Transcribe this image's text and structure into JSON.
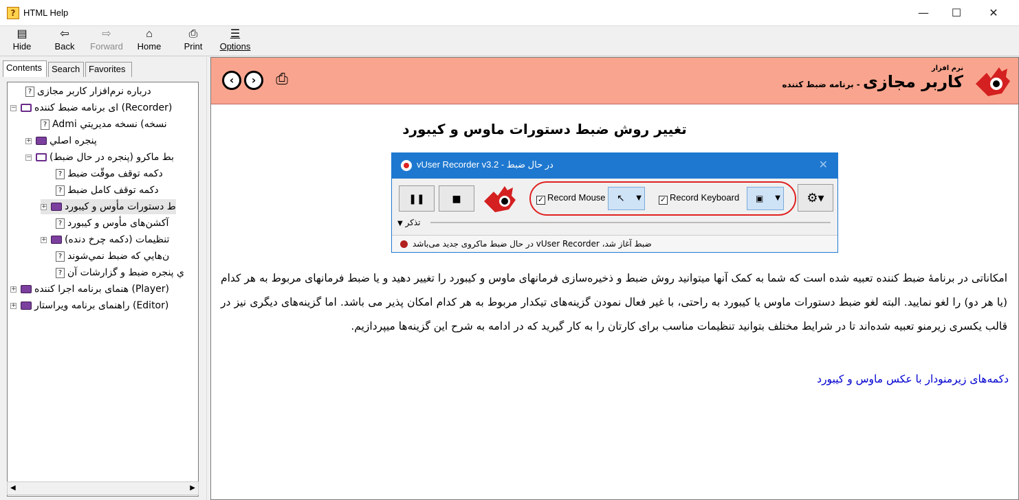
{
  "window": {
    "title": "HTML Help",
    "min": "—",
    "max": "☐",
    "close": "✕"
  },
  "toolbar": {
    "hide": "Hide",
    "back": "Back",
    "forward": "Forward",
    "home": "Home",
    "print": "Print",
    "options": "Options"
  },
  "tabs": {
    "contents": "Contents",
    "search": "Search",
    "favorites": "Favorites"
  },
  "tree": [
    "درباره نرم‌افزار کاربر مجازی",
    "ای برنامه ضبط کننده (Recorder)",
    "Admi نسخه) نسخه مديريتي",
    "پنجره اصلي",
    "بط ماکرو (پنجره در حال ضبط)",
    "دکمه توقف موقّت ضبط",
    "دکمه توقف کامل ضبط",
    "ط دستورات مأوس و کيبورد",
    "آکشن‌های مأوس و کیبورد",
    "تنظيمات (دکمه چرخ دنده)",
    "ن‌هايي که ضبط نمي‌شوند",
    "ي پنجره ضبط و گزارشات آن",
    "هنمای برنامه اجرا کننده (Player)",
    "راهنمای برنامه ویراستار (Editor)"
  ],
  "banner": {
    "brand_small": "نرم افزار",
    "brand_big": "کاربر مجازی",
    "brand_sub": "- برنامه ضبط کننده"
  },
  "page": {
    "title": "تغییر روش ضبط دستورات ماوس و کیبورد",
    "paragraph": "امکاناتی در برنامهٔ ضبط کننده تعبیه شده است که شما به کمک آنها میتوانید روش ضبط و ذخیره‌سازی فرمانهای ماوس و کیبورد را تغییر دهید و یا ضبط فرمانهای مربوط به هر کدام (یا هر دو) را لغو نمایید. البته لغو ضبط دستورات ماوس یا کیبورد به راحتی، با غیر فعال نمودن گزینه‌های تیکدار مربوط به هر کدام امکان پذیر می باشد. اما گزینه‌های دیگری نیز در قالب یکسری زیرمنو تعبیه شده‌اند تا در شرایط مختلف بتوانید تنظیمات مناسب برای کارتان را به کار گیرید که در ادامه به شرح این گزینه‌ها میپردازیم.",
    "link": "دکمه‌های زیرمنودار با عکس ماوس و کیبورد"
  },
  "screenshot": {
    "title": "vUser Recorder v3.2 - در حال ضبط",
    "record_mouse": "Record Mouse",
    "record_keyboard": "Record Keyboard",
    "notes": "تذکر",
    "status": "ضبط آغاز شد، vUser Recorder در حال ضبط ماکروی جدید می‌باشد"
  }
}
